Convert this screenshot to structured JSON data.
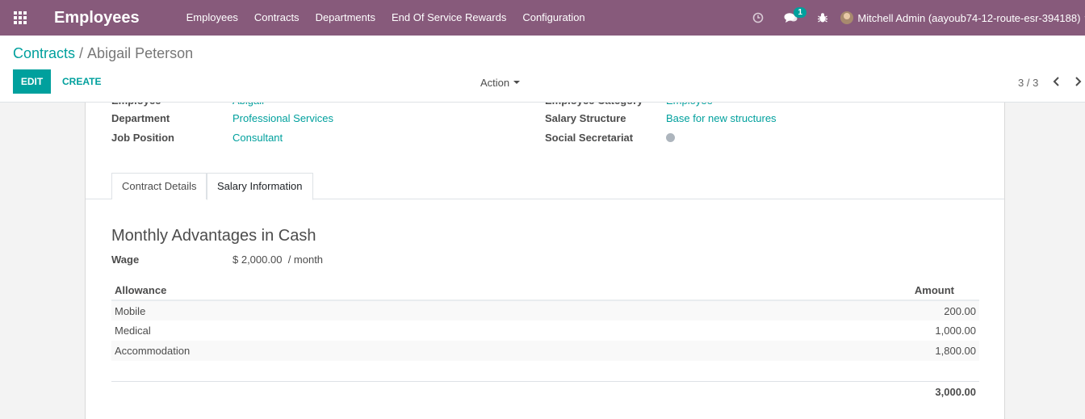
{
  "navbar": {
    "brand": "Employees",
    "menu": [
      "Employees",
      "Contracts",
      "Departments",
      "End Of Service Rewards",
      "Configuration"
    ],
    "messages_badge": "1",
    "user_name": "Mitchell Admin (aayoub74-12-route-esr-394188)"
  },
  "breadcrumb": {
    "parent": "Contracts",
    "separator": "/",
    "current": "Abigail Peterson"
  },
  "toolbar": {
    "edit_label": "EDIT",
    "create_label": "CREATE",
    "action_label": "Action",
    "pager": "3 / 3"
  },
  "form": {
    "fields_left": [
      {
        "label": "Department",
        "value": "Professional Services"
      },
      {
        "label": "Job Position",
        "value": "Consultant"
      }
    ],
    "fields_right": [
      {
        "label": "Salary Structure",
        "value": "Base for new structures"
      },
      {
        "label": "Social Secretariat",
        "value": ""
      }
    ],
    "tabs": [
      "Contract Details",
      "Salary Information"
    ],
    "active_tab": "Salary Information",
    "section_title": "Monthly Advantages in Cash",
    "wage": {
      "label": "Wage",
      "value": "$ 2,000.00",
      "suffix": "/ month"
    },
    "allowance_table": {
      "headers": [
        "Allowance",
        "Amount"
      ],
      "rows": [
        {
          "name": "Mobile",
          "amount": "200.00"
        },
        {
          "name": "Medical",
          "amount": "1,000.00"
        },
        {
          "name": "Accommodation",
          "amount": "1,800.00"
        }
      ],
      "total": "3,000.00"
    }
  },
  "colors": {
    "navbar": "#875a7b",
    "primary": "#00a09d",
    "status_dot": "#adb5bd"
  },
  "icons": [
    "apps-grid-icon",
    "clock-icon",
    "chat-icon",
    "bug-icon",
    "chevron-left-icon",
    "chevron-right-icon"
  ]
}
